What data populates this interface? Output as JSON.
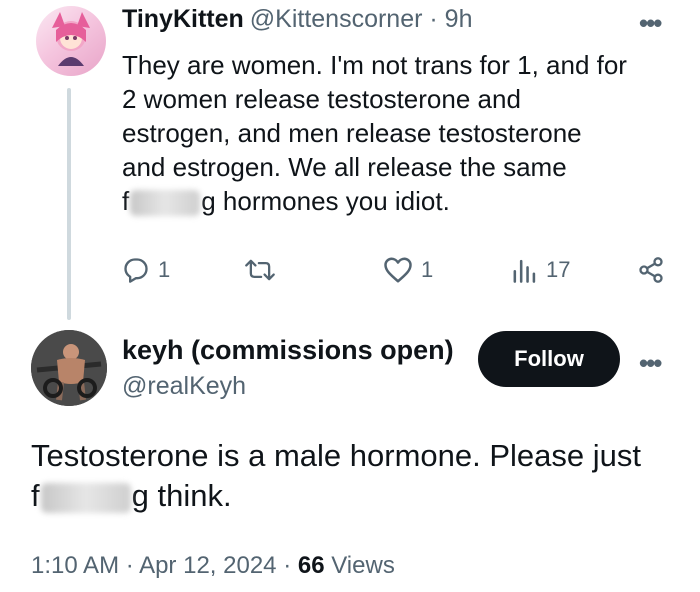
{
  "reply": {
    "display_name": "TinyKitten",
    "handle": "@Kittenscorner",
    "sep": "·",
    "time": "9h",
    "lines": [
      "They are women.  I'm not trans for 1, and for",
      "2 women release testosterone and",
      "estrogen, and men release testosterone",
      "and estrogen.  We all release the same"
    ],
    "last_line_start": "f",
    "last_line_end": "g hormones you idiot.",
    "actions": {
      "reply_count": "1",
      "like_count": "1",
      "views_count": "17"
    }
  },
  "main": {
    "display_name": "keyh (commissions open)",
    "handle": "@realKeyh",
    "follow_label": "Follow",
    "line1": "Testosterone is a male hormone. Please just",
    "line2_start": "f",
    "line2_end": "g think.",
    "time": "1:10 AM",
    "sep": "·",
    "date": "Apr 12, 2024",
    "views_count": "66",
    "views_label": "Views"
  },
  "colors": {
    "text": "#0f1419",
    "muted": "#536471",
    "thread_line": "#cfd9de",
    "follow_bg": "#0f1419"
  },
  "icons": [
    "reply-icon",
    "retweet-icon",
    "like-icon",
    "views-icon",
    "share-icon",
    "more-icon"
  ]
}
